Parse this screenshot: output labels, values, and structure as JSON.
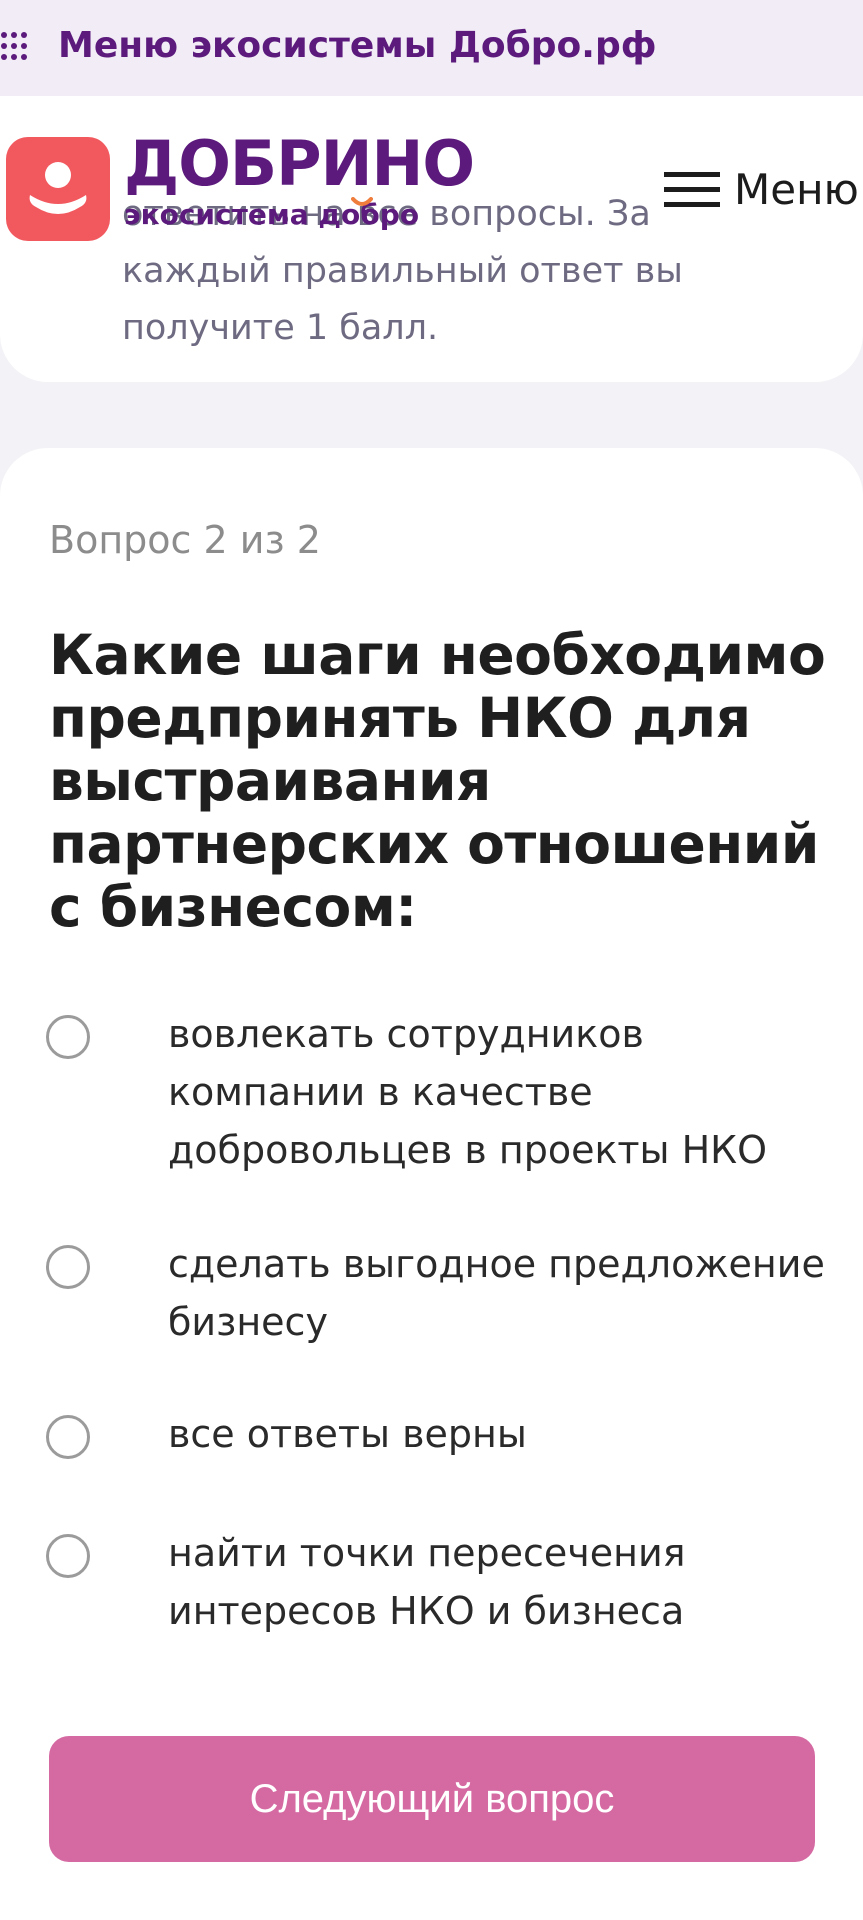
{
  "ecosystem_bar": {
    "icon": "grid-dots-icon",
    "title": "Меню экосистемы Добро.рф"
  },
  "intro": {
    "text": "ответить на все вопросы. За каждый правильный ответ вы получите 1 балл."
  },
  "header": {
    "logo_icon": "person-icon",
    "brand_name": "ДОБРИНО",
    "brand_sub_prefix": "экосистема ",
    "brand_sub_accent": "добро",
    "menu_icon": "hamburger-icon",
    "menu_label": "Меню"
  },
  "quiz": {
    "progress": "Вопрос 2 из 2",
    "question": "Какие шаги необходимо предпринять НКО для выстраивания партнерских отношений с бизнесом:",
    "options": [
      {
        "label": "вовлекать сотрудников компании в качестве добровольцев в проекты НКО",
        "selected": false
      },
      {
        "label": "сделать выгодное предложение бизнесу",
        "selected": false
      },
      {
        "label": "все ответы верны",
        "selected": false
      },
      {
        "label": "найти точки пересечения интересов НКО и бизнеса",
        "selected": false
      }
    ],
    "next_button": "Следующий вопрос"
  },
  "colors": {
    "brand": "#5b1a7c",
    "logo": "#f2595f",
    "button": "#d56aa3",
    "smile": "#ef7d3c"
  }
}
